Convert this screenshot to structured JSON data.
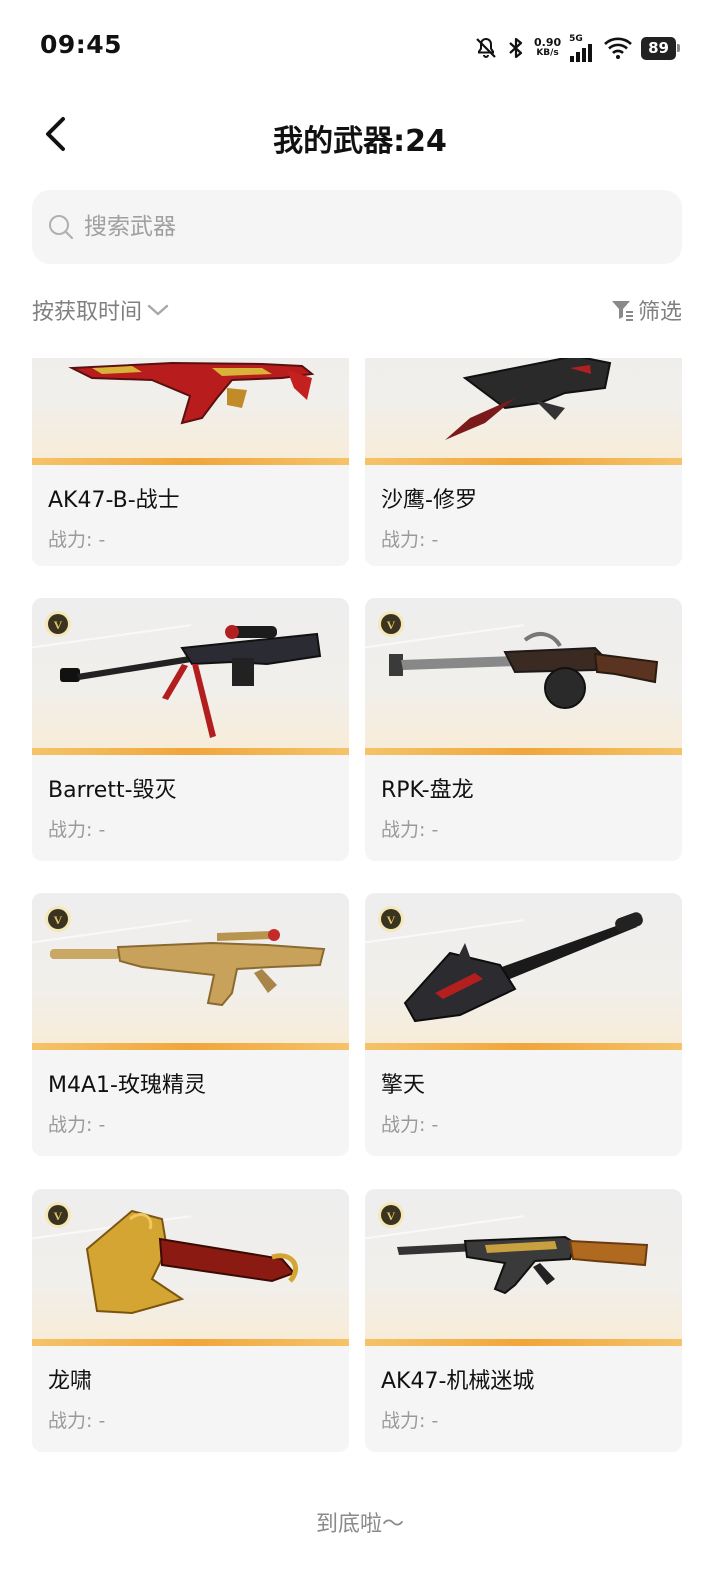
{
  "status_bar": {
    "time": "09:45",
    "net_speed_value": "0.90",
    "net_speed_unit": "KB/s",
    "network_type": "5G",
    "battery": "89",
    "icons": [
      "bell-muted-icon",
      "bluetooth-icon",
      "signal-icon",
      "wifi-icon",
      "battery-icon"
    ]
  },
  "header": {
    "title": "我的武器:24",
    "back_icon": "chevron-left-icon"
  },
  "search": {
    "placeholder": "搜索武器",
    "value": ""
  },
  "sort": {
    "label": "按获取时间",
    "icon": "chevron-down-icon"
  },
  "filter": {
    "label": "筛选",
    "icon": "filter-icon"
  },
  "colors": {
    "accent_bar": "#f0a63a",
    "card_bg": "#f5f5f5",
    "badge": "#c9a444"
  },
  "weapons": [
    {
      "name": "AK47-B-战士",
      "power": "战力: -",
      "badge": false
    },
    {
      "name": "沙鹰-修罗",
      "power": "战力: -",
      "badge": false
    },
    {
      "name": "Barrett-毁灭",
      "power": "战力: -",
      "badge": true
    },
    {
      "name": "RPK-盘龙",
      "power": "战力: -",
      "badge": true
    },
    {
      "name": "M4A1-玫瑰精灵",
      "power": "战力: -",
      "badge": true
    },
    {
      "name": "擎天",
      "power": "战力: -",
      "badge": true
    },
    {
      "name": "龙啸",
      "power": "战力: -",
      "badge": true
    },
    {
      "name": "AK47-机械迷城",
      "power": "战力: -",
      "badge": true
    }
  ],
  "footer": {
    "end_text": "到底啦～"
  }
}
